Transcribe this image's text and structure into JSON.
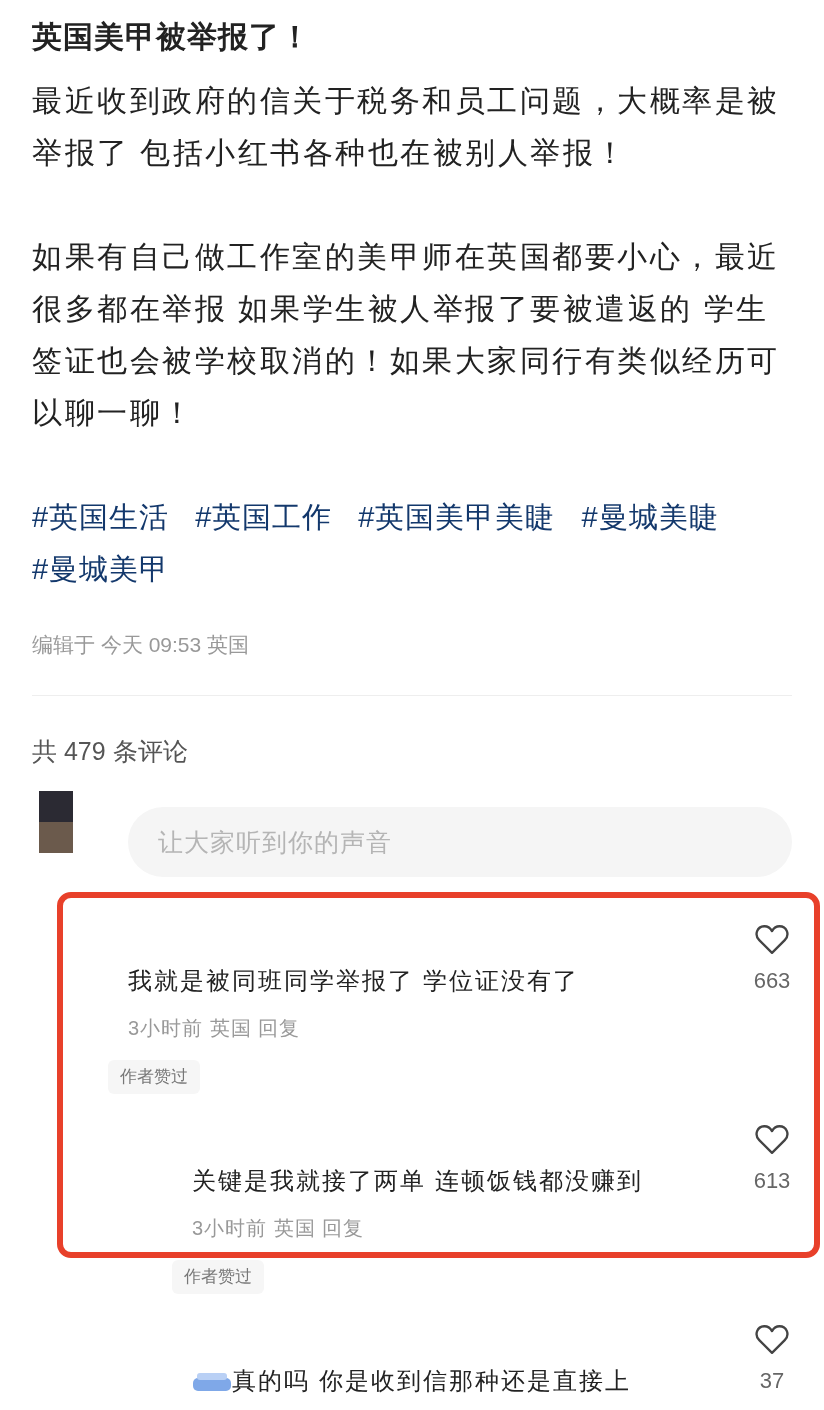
{
  "post": {
    "title": "英国美甲被举报了！",
    "paragraphs": [
      "最近收到政府的信关于税务和员工问题，大概率是被举报了 包括小红书各种也在被别人举报！",
      "如果有自己做工作室的美甲师在英国都要小心，最近很多都在举报 如果学生被人举报了要被遣返的 学生签证也会被学校取消的！如果大家同行有类似经历可以聊一聊！"
    ],
    "tags": [
      "#英国生活",
      "#英国工作",
      "#英国美甲美睫",
      "#曼城美睫",
      "#曼城美甲"
    ],
    "edited": "编辑于 今天 09:53 英国"
  },
  "comments_header": {
    "count": "共 479 条评论",
    "input": {
      "placeholder": "让大家听到你的声音"
    }
  },
  "comments": [
    {
      "kind": "top",
      "sticker": false,
      "text": "我就是被同班同学举报了 学位证没有了",
      "meta": "3小时前 英国 回复",
      "badge": "作者赞过",
      "likes": "663"
    },
    {
      "kind": "reply",
      "sticker": false,
      "text": "关键是我就接了两单 连顿饭钱都没赚到",
      "meta": "3小时前 英国 回复",
      "badge": "作者赞过",
      "likes": "613"
    },
    {
      "kind": "reply",
      "sticker": true,
      "text": "真的吗 你是收到信那种还是直接上",
      "likes": "37"
    }
  ],
  "annotation": {
    "kind": "highlight-box",
    "color": "#e8402a"
  }
}
